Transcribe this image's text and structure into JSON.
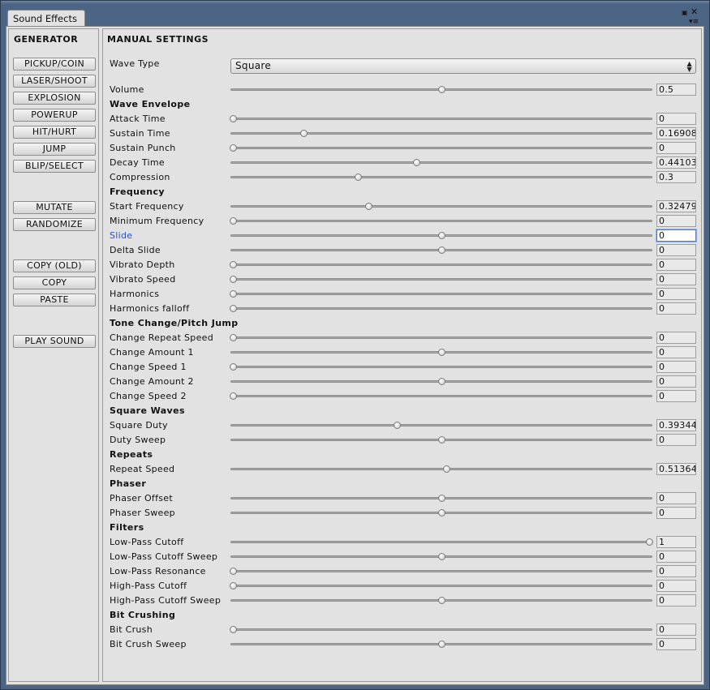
{
  "window": {
    "tab_title": "Sound Effects"
  },
  "generator": {
    "title": "GENERATOR",
    "buttons": [
      {
        "label": "PICKUP/COIN",
        "name": "pickup-coin-button"
      },
      {
        "label": "LASER/SHOOT",
        "name": "laser-shoot-button"
      },
      {
        "label": "EXPLOSION",
        "name": "explosion-button"
      },
      {
        "label": "POWERUP",
        "name": "powerup-button"
      },
      {
        "label": "HIT/HURT",
        "name": "hit-hurt-button"
      },
      {
        "label": "JUMP",
        "name": "jump-button"
      },
      {
        "label": "BLIP/SELECT",
        "name": "blip-select-button"
      },
      {
        "label": "MUTATE",
        "name": "mutate-button"
      },
      {
        "label": "RANDOMIZE",
        "name": "randomize-button"
      },
      {
        "label": "COPY (OLD)",
        "name": "copy-old-button"
      },
      {
        "label": "COPY",
        "name": "copy-button"
      },
      {
        "label": "PASTE",
        "name": "paste-button"
      },
      {
        "label": "PLAY SOUND",
        "name": "play-sound-button"
      }
    ]
  },
  "manual": {
    "title": "MANUAL SETTINGS",
    "wave_type_label": "Wave Type",
    "wave_type_value": "Square",
    "rows": [
      {
        "kind": "slider",
        "label": "Volume",
        "value": "0.5",
        "level": 0.5
      },
      {
        "kind": "section",
        "label": "Wave Envelope"
      },
      {
        "kind": "slider",
        "label": "Attack Time",
        "value": "0",
        "level": 0
      },
      {
        "kind": "slider",
        "label": "Sustain Time",
        "value": "0.16908",
        "level": 0.16908
      },
      {
        "kind": "slider",
        "label": "Sustain Punch",
        "value": "0",
        "level": 0
      },
      {
        "kind": "slider",
        "label": "Decay Time",
        "value": "0.44103",
        "level": 0.44103
      },
      {
        "kind": "slider",
        "label": "Compression",
        "value": "0.3",
        "level": 0.3
      },
      {
        "kind": "section",
        "label": "Frequency"
      },
      {
        "kind": "slider",
        "label": "Start Frequency",
        "value": "0.32479",
        "level": 0.32479
      },
      {
        "kind": "slider",
        "label": "Minimum Frequency",
        "value": "0",
        "level": 0
      },
      {
        "kind": "slider",
        "label": "Slide",
        "value": "0",
        "level": 0.5,
        "focused": true
      },
      {
        "kind": "slider",
        "label": "Delta Slide",
        "value": "0",
        "level": 0.5
      },
      {
        "kind": "slider",
        "label": "Vibrato Depth",
        "value": "0",
        "level": 0
      },
      {
        "kind": "slider",
        "label": "Vibrato Speed",
        "value": "0",
        "level": 0
      },
      {
        "kind": "slider",
        "label": "Harmonics",
        "value": "0",
        "level": 0
      },
      {
        "kind": "slider",
        "label": "Harmonics falloff",
        "value": "0",
        "level": 0
      },
      {
        "kind": "section",
        "label": "Tone Change/Pitch Jump"
      },
      {
        "kind": "slider",
        "label": "Change Repeat Speed",
        "value": "0",
        "level": 0
      },
      {
        "kind": "slider",
        "label": "Change Amount 1",
        "value": "0",
        "level": 0.5
      },
      {
        "kind": "slider",
        "label": "Change Speed 1",
        "value": "0",
        "level": 0
      },
      {
        "kind": "slider",
        "label": "Change Amount 2",
        "value": "0",
        "level": 0.5
      },
      {
        "kind": "slider",
        "label": "Change Speed 2",
        "value": "0",
        "level": 0
      },
      {
        "kind": "section",
        "label": "Square Waves"
      },
      {
        "kind": "slider",
        "label": "Square Duty",
        "value": "0.39344",
        "level": 0.39344
      },
      {
        "kind": "slider",
        "label": "Duty Sweep",
        "value": "0",
        "level": 0.5
      },
      {
        "kind": "section",
        "label": "Repeats"
      },
      {
        "kind": "slider",
        "label": "Repeat Speed",
        "value": "0.51364",
        "level": 0.51364
      },
      {
        "kind": "section",
        "label": "Phaser"
      },
      {
        "kind": "slider",
        "label": "Phaser Offset",
        "value": "0",
        "level": 0.5
      },
      {
        "kind": "slider",
        "label": "Phaser Sweep",
        "value": "0",
        "level": 0.5
      },
      {
        "kind": "section",
        "label": "Filters"
      },
      {
        "kind": "slider",
        "label": "Low-Pass Cutoff",
        "value": "1",
        "level": 1
      },
      {
        "kind": "slider",
        "label": "Low-Pass Cutoff Sweep",
        "value": "0",
        "level": 0.5
      },
      {
        "kind": "slider",
        "label": "Low-Pass Resonance",
        "value": "0",
        "level": 0
      },
      {
        "kind": "slider",
        "label": "High-Pass Cutoff",
        "value": "0",
        "level": 0
      },
      {
        "kind": "slider",
        "label": "High-Pass Cutoff Sweep",
        "value": "0",
        "level": 0.5
      },
      {
        "kind": "section",
        "label": "Bit Crushing"
      },
      {
        "kind": "slider",
        "label": "Bit Crush",
        "value": "0",
        "level": 0
      },
      {
        "kind": "slider",
        "label": "Bit Crush Sweep",
        "value": "0",
        "level": 0.5
      }
    ]
  }
}
